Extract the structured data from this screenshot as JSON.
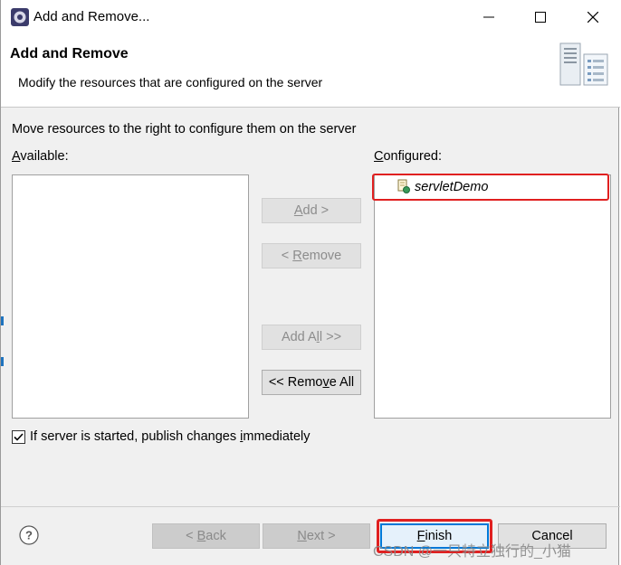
{
  "window": {
    "title": "Add and Remove...",
    "icon": "eclipse-gear-icon"
  },
  "banner": {
    "title": "Add and Remove",
    "description": "Modify the resources that are configured on the server",
    "icon": "server-icon"
  },
  "instructions": "Move resources to the right to configure them on the server",
  "available": {
    "label_prefix": "",
    "label_mnemonic": "A",
    "label_rest": "vailable:",
    "items": []
  },
  "configured": {
    "label_mnemonic": "C",
    "label_rest": "onfigured:",
    "items": [
      {
        "label": "servletDemo",
        "icon": "web-module-icon"
      }
    ]
  },
  "buttons": {
    "add": {
      "mnemonic": "A",
      "rest": "dd >"
    },
    "remove": {
      "prefix": "< ",
      "mnemonic": "R",
      "rest": "emove"
    },
    "add_all": {
      "prefix": "Add A",
      "mnemonic": "l",
      "rest": "l >>"
    },
    "remove_all": {
      "prefix": "<< Remo",
      "mnemonic": "v",
      "rest": "e All"
    }
  },
  "publish_option": {
    "checked": true,
    "prefix": "If server is started, publish changes ",
    "mnemonic": "i",
    "rest": "mmediately"
  },
  "footer": {
    "back": {
      "prefix": "< ",
      "mnemonic": "B",
      "rest": "ack"
    },
    "next": {
      "mnemonic": "N",
      "rest": "ext >"
    },
    "finish": {
      "mnemonic": "F",
      "rest": "inish"
    },
    "cancel": "Cancel",
    "help_icon": "help-icon"
  },
  "watermark": "CSDN @一只特立独行的_小猫",
  "highlight_color": "#e02020"
}
